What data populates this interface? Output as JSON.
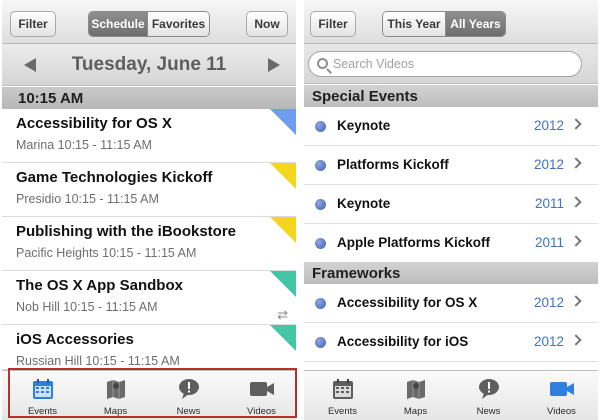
{
  "left": {
    "toolbar": {
      "filter_label": "Filter",
      "segments": [
        {
          "label": "Schedule",
          "active": true
        },
        {
          "label": "Favorites",
          "active": false
        }
      ],
      "now_label": "Now"
    },
    "date": {
      "title": "Tuesday, June 11",
      "prev_icon": "left-triangle-icon",
      "next_icon": "right-triangle-icon"
    },
    "time_header": "10:15 AM",
    "sessions": [
      {
        "title": "Accessibility for OS X",
        "subtitle": "Marina 10:15 - 11:15 AM",
        "corner_color": "#6f9bf0"
      },
      {
        "title": "Game Technologies Kickoff",
        "subtitle": "Presidio 10:15 - 11:15 AM",
        "corner_color": "#f2d71c"
      },
      {
        "title": "Publishing with the iBookstore",
        "subtitle": "Pacific Heights 10:15 - 11:15 AM",
        "corner_color": "#f2d71c"
      },
      {
        "title": "The OS X App Sandbox",
        "subtitle": "Nob Hill 10:15 - 11:15 AM",
        "corner_color": "#43c6a6"
      },
      {
        "title": "iOS Accessories",
        "subtitle": "Russian Hill 10:15 - 11:15 AM",
        "corner_color": "#43c6a6"
      }
    ]
  },
  "right": {
    "toolbar": {
      "filter_label": "Filter",
      "segments": [
        {
          "label": "This Year",
          "active": false
        },
        {
          "label": "All Years",
          "active": true
        }
      ]
    },
    "search": {
      "placeholder": "Search Videos"
    },
    "sections": [
      {
        "header": "Special Events",
        "rows": [
          {
            "title": "Keynote",
            "year": "2012"
          },
          {
            "title": "Platforms Kickoff",
            "year": "2012"
          },
          {
            "title": "Keynote",
            "year": "2011"
          },
          {
            "title": "Apple Platforms Kickoff",
            "year": "2011"
          }
        ]
      },
      {
        "header": "Frameworks",
        "rows": [
          {
            "title": "Accessibility for OS X",
            "year": "2012"
          },
          {
            "title": "Accessibility for iOS",
            "year": "2012"
          }
        ]
      }
    ]
  },
  "tabs": [
    {
      "label": "Events",
      "icon": "calendar-icon"
    },
    {
      "label": "Maps",
      "icon": "map-icon"
    },
    {
      "label": "News",
      "icon": "speech-bubble-icon"
    },
    {
      "label": "Videos",
      "icon": "video-camera-icon"
    }
  ],
  "colors": {
    "selected_tab": "#2f7fe0",
    "unselected_tab": "#555555",
    "highlight_box": "#b3312f"
  }
}
